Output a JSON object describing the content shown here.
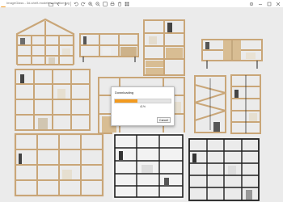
{
  "window": {
    "title": "ImageGlass - 3d-shelf-models-collection.jpg"
  },
  "toolbar": {
    "icons": [
      "open-icon",
      "prev-icon",
      "next-icon",
      "rotate-left-icon",
      "rotate-right-icon",
      "zoom-in-icon",
      "zoom-out-icon",
      "fit-icon",
      "print-icon",
      "delete-icon",
      "gallery-icon"
    ]
  },
  "window_controls": [
    "settings-icon",
    "minimize-icon",
    "maximize-icon",
    "close-icon"
  ],
  "dialog": {
    "title": "Downloading",
    "progress": 0.41,
    "percent_label": "41%",
    "cancel_label": "Cancel"
  },
  "colors": {
    "accent": "#f39a1e",
    "wood": "#d9b98e",
    "wood_dark": "#a8875e",
    "black_shelf": "#1f1f1f",
    "canvas": "#ebebeb"
  }
}
